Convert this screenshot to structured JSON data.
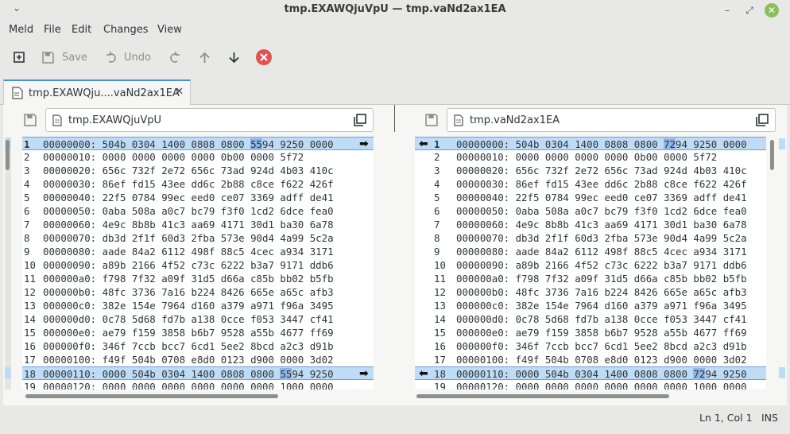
{
  "window": {
    "title": "tmp.EXAWQjuVpU — tmp.vaNd2ax1EA",
    "menu_glyph": "⌄",
    "min_glyph": "–",
    "max_glyph": "⤢",
    "close_glyph": "✕"
  },
  "menubar": {
    "items": [
      "Meld",
      "File",
      "Edit",
      "Changes",
      "View"
    ]
  },
  "toolbar": {
    "save_label": "Save",
    "undo_label": "Undo"
  },
  "tab": {
    "label": "tmp.EXAWQju....vaNd2ax1EA",
    "close_glyph": "✕"
  },
  "left": {
    "path": "tmp.EXAWQjuVpU",
    "rows": [
      {
        "n": "1",
        "pre": "00000000: 504b 0304 1400 0808 0800 ",
        "hl": "55",
        "post": "94 9250 0000"
      },
      {
        "n": "2",
        "text": "00000010: 0000 0000 0000 0000 0b00 0000 5f72"
      },
      {
        "n": "3",
        "text": "00000020: 656c 732f 2e72 656c 73ad 924d 4b03 410c"
      },
      {
        "n": "4",
        "text": "00000030: 86ef fd15 43ee dd6c 2b88 c8ce f622 426f"
      },
      {
        "n": "5",
        "text": "00000040: 22f5 0784 99ec eed0 ce07 3369 adff de41"
      },
      {
        "n": "6",
        "text": "00000050: 0aba 508a a0c7 bc79 f3f0 1cd2 6dce fea0"
      },
      {
        "n": "7",
        "text": "00000060: 4e9c 8b8b 41c3 aa69 4171 30d1 ba30 6a78"
      },
      {
        "n": "8",
        "text": "00000070: db3d 2f1f 60d3 2fba 573e 90d4 4a99 5c2a"
      },
      {
        "n": "9",
        "text": "00000080: aade 84a2 6112 498f 88c5 4cec a934 3171"
      },
      {
        "n": "10",
        "text": "00000090: a89b 2166 4f52 c73c 6222 b3a7 9171 ddb6"
      },
      {
        "n": "11",
        "text": "000000a0: f798 7f32 a09f 31d5 d66a c85b bb02 b5fb"
      },
      {
        "n": "12",
        "text": "000000b0: 48fc 3736 7a16 b224 8426 665e a65c afb3"
      },
      {
        "n": "13",
        "text": "000000c0: 382e 154e 7964 d160 a379 a971 f96a 3495"
      },
      {
        "n": "14",
        "text": "000000d0: 0c78 5d68 fd7b a138 0cce f053 3447 cf41"
      },
      {
        "n": "15",
        "text": "000000e0: ae79 f159 3858 b6b7 9528 a55b 4677 ff69"
      },
      {
        "n": "16",
        "text": "000000f0: 346f 7ccb bcc7 6cd1 5ee2 8bcd a2c3 d91b"
      },
      {
        "n": "17",
        "text": "00000100: f49f 504b 0708 e8d0 0123 d900 0000 3d02"
      },
      {
        "n": "18",
        "pre": "00000110: 0000 504b 0304 1400 0808 0800 ",
        "hl": "55",
        "post": "94 9250"
      },
      {
        "n": "19",
        "text": "00000120: 0000 0000 0000 0000 0000 0000 1000 0000"
      }
    ]
  },
  "right": {
    "path": "tmp.vaNd2ax1EA",
    "rows": [
      {
        "n": "1",
        "pre": "00000000: 504b 0304 1400 0808 0800 ",
        "hl": "72",
        "post": "94 9250 0000"
      },
      {
        "n": "2",
        "text": "00000010: 0000 0000 0000 0000 0b00 0000 5f72"
      },
      {
        "n": "3",
        "text": "00000020: 656c 732f 2e72 656c 73ad 924d 4b03 410c"
      },
      {
        "n": "4",
        "text": "00000030: 86ef fd15 43ee dd6c 2b88 c8ce f622 426f"
      },
      {
        "n": "5",
        "text": "00000040: 22f5 0784 99ec eed0 ce07 3369 adff de41"
      },
      {
        "n": "6",
        "text": "00000050: 0aba 508a a0c7 bc79 f3f0 1cd2 6dce fea0"
      },
      {
        "n": "7",
        "text": "00000060: 4e9c 8b8b 41c3 aa69 4171 30d1 ba30 6a78"
      },
      {
        "n": "8",
        "text": "00000070: db3d 2f1f 60d3 2fba 573e 90d4 4a99 5c2a"
      },
      {
        "n": "9",
        "text": "00000080: aade 84a2 6112 498f 88c5 4cec a934 3171"
      },
      {
        "n": "10",
        "text": "00000090: a89b 2166 4f52 c73c 6222 b3a7 9171 ddb6"
      },
      {
        "n": "11",
        "text": "000000a0: f798 7f32 a09f 31d5 d66a c85b bb02 b5fb"
      },
      {
        "n": "12",
        "text": "000000b0: 48fc 3736 7a16 b224 8426 665e a65c afb3"
      },
      {
        "n": "13",
        "text": "000000c0: 382e 154e 7964 d160 a379 a971 f96a 3495"
      },
      {
        "n": "14",
        "text": "000000d0: 0c78 5d68 fd7b a138 0cce f053 3447 cf41"
      },
      {
        "n": "15",
        "text": "000000e0: ae79 f159 3858 b6b7 9528 a55b 4677 ff69"
      },
      {
        "n": "16",
        "text": "000000f0: 346f 7ccb bcc7 6cd1 5ee2 8bcd a2c3 d91b"
      },
      {
        "n": "17",
        "text": "00000100: f49f 504b 0708 e8d0 0123 d900 0000 3d02"
      },
      {
        "n": "18",
        "pre": "00000110: 0000 504b 0304 1400 0808 0800 ",
        "hl": "72",
        "post": "94 9250"
      },
      {
        "n": "19",
        "text": "00000120: 0000 0000 0000 0000 0000 0000 1000 0000"
      }
    ]
  },
  "glyphs": {
    "arrow_right": "➡",
    "arrow_left": "⬅"
  },
  "status": {
    "position": "Ln 1, Col 1",
    "mode": "INS"
  },
  "colors": {
    "highlight_row": "#bfdcf6",
    "changed_bytes": "#8fb6e8",
    "close_button": "#8bbf5e",
    "stop_icon": "#e0524f"
  }
}
